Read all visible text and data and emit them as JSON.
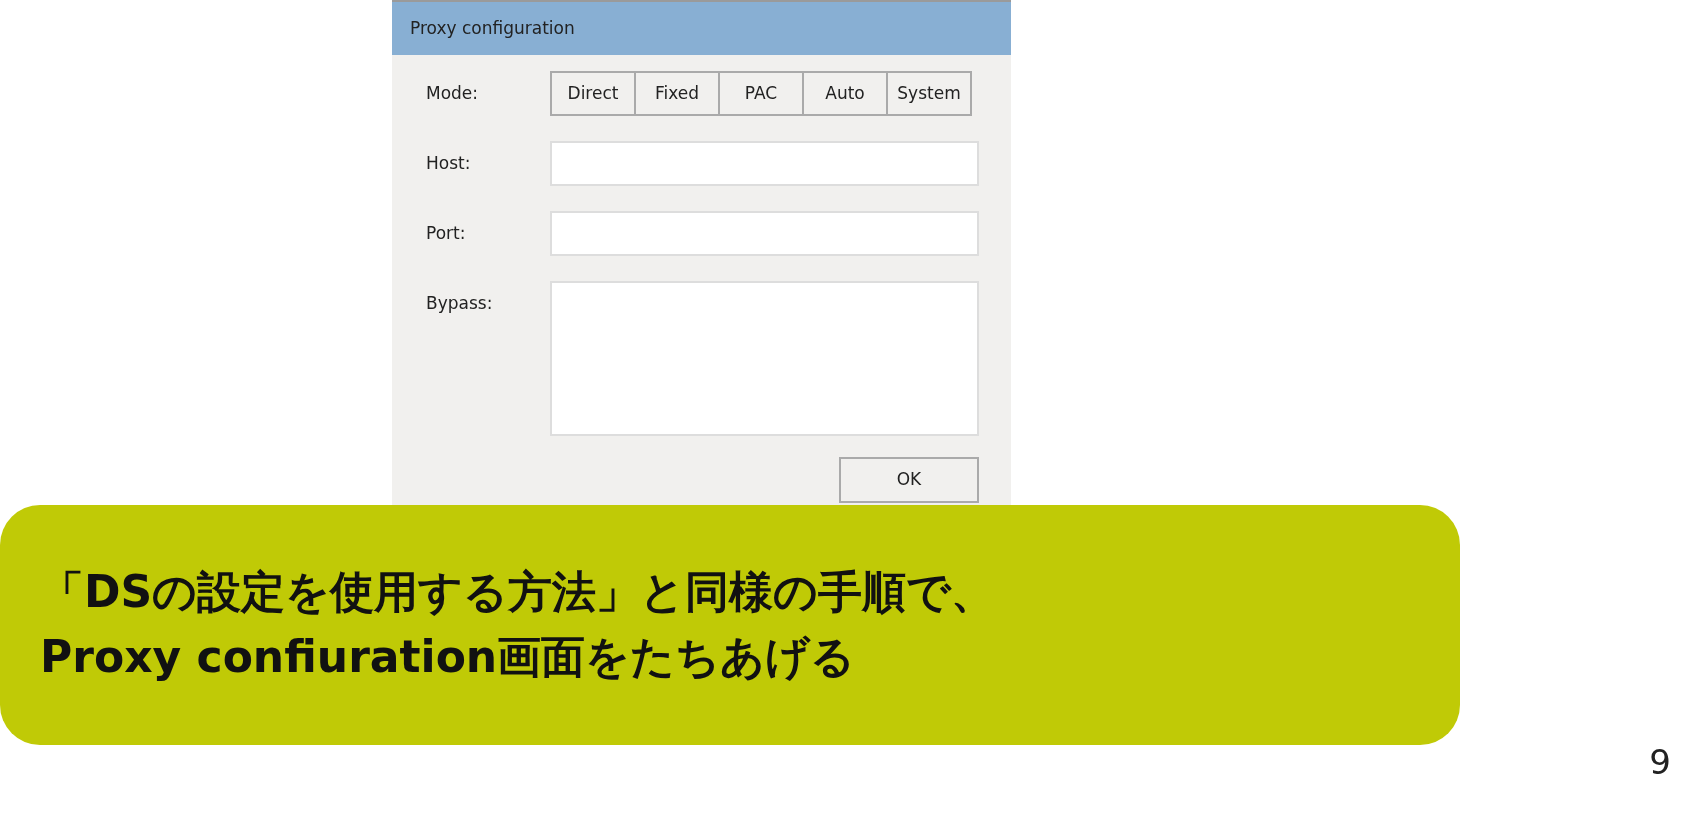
{
  "dialog": {
    "title": "Proxy configuration",
    "mode": {
      "label": "Mode:",
      "options": [
        "Direct",
        "Fixed",
        "PAC",
        "Auto",
        "System"
      ]
    },
    "fields": [
      {
        "label": "Host:",
        "kind": "line"
      },
      {
        "label": "Port:",
        "kind": "line"
      },
      {
        "label": "Bypass:",
        "kind": "area"
      }
    ],
    "ok_button": "OK"
  },
  "callout": {
    "lines": [
      "「DSの設定を使用する方法」と同様の手順で、",
      "Proxy confiuration画面をたちあげる"
    ]
  },
  "page_number": "9"
}
